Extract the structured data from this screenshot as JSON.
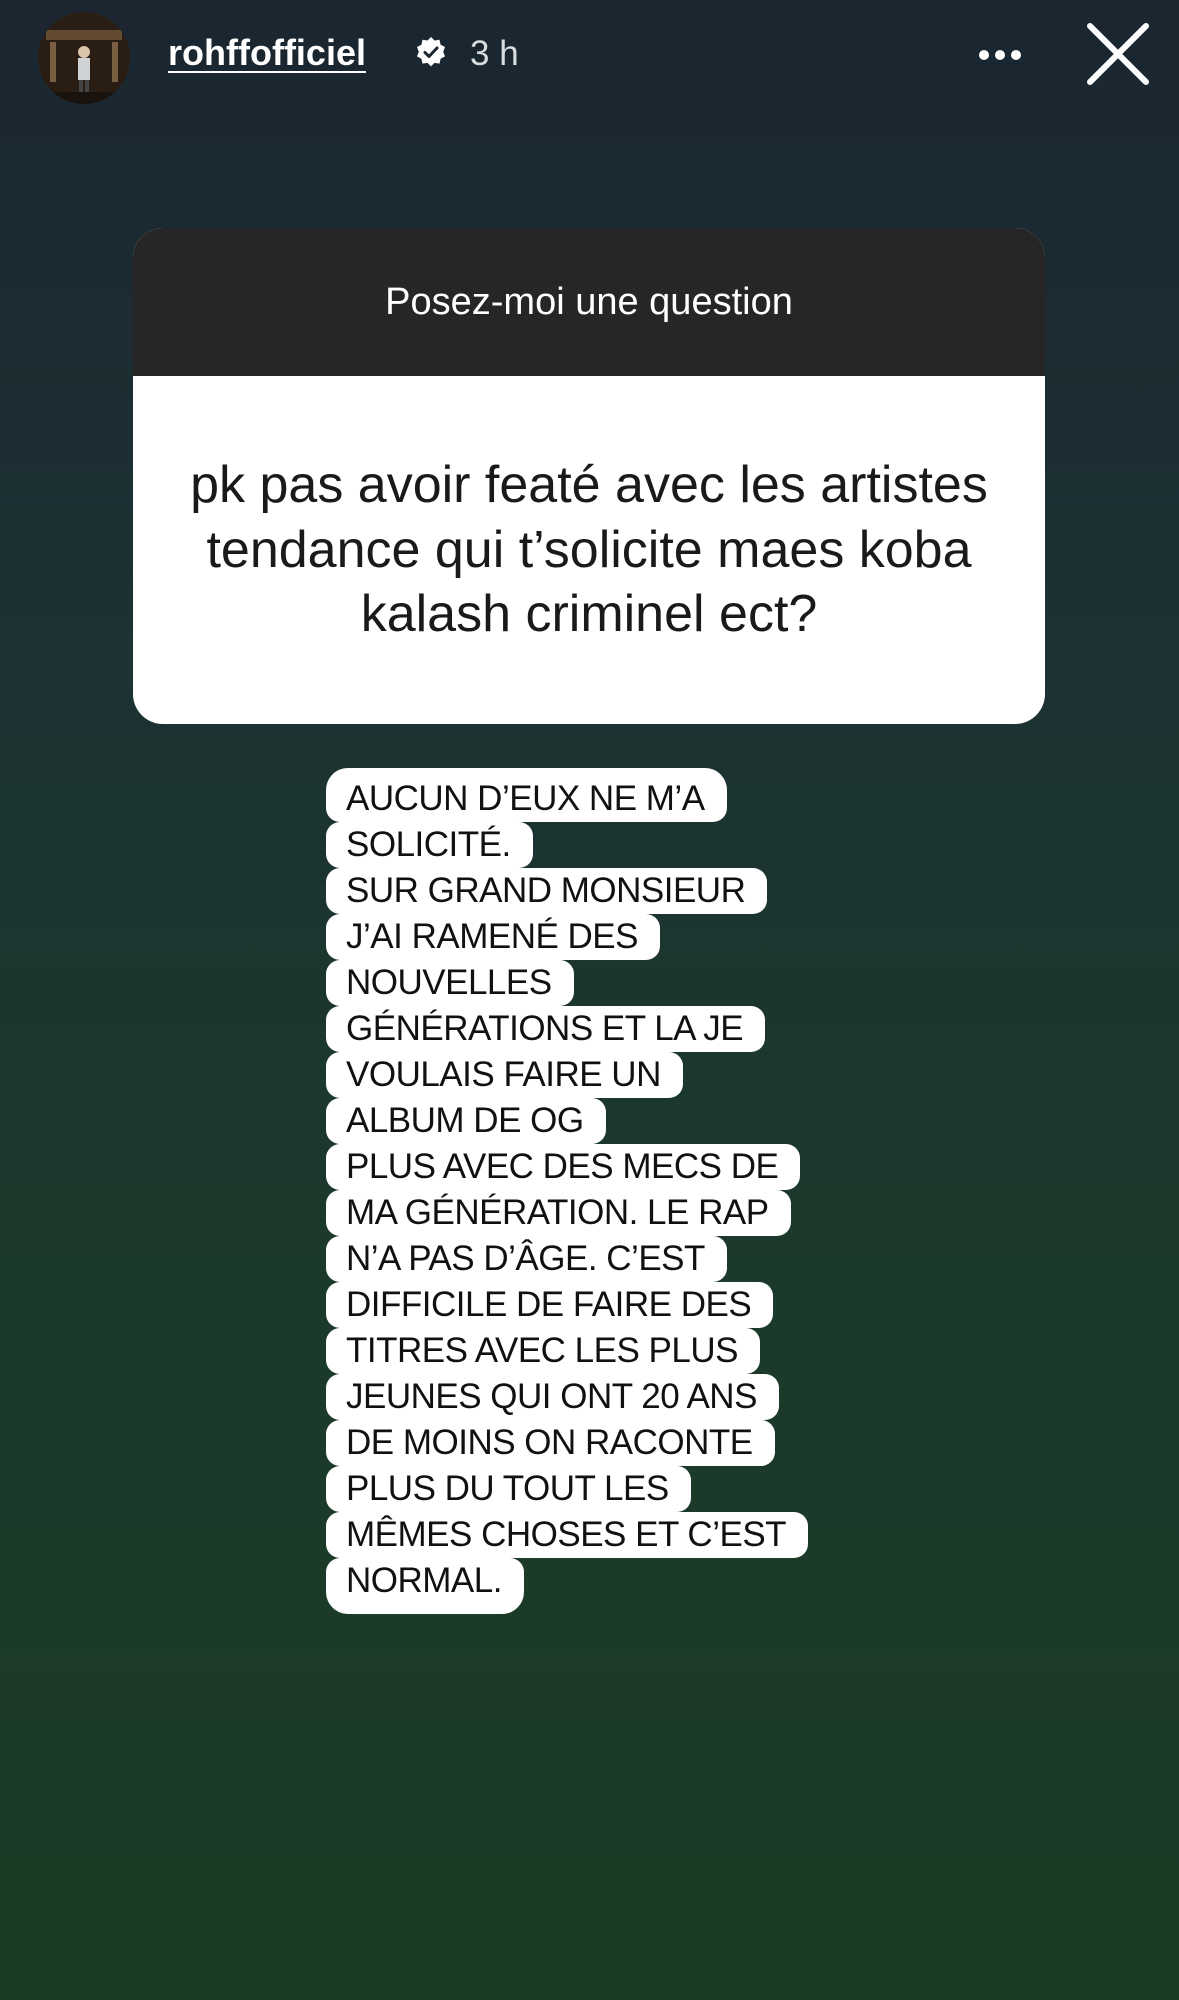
{
  "header": {
    "username": "rohffofficiel",
    "time": "3 h",
    "verified_icon": "verified-badge-icon",
    "more_icon": "more-horizontal-icon",
    "close_icon": "close-icon"
  },
  "question_card": {
    "header_text": "Posez-moi une question",
    "question_text": "pk pas avoir featé avec les artistes tendance qui t’solicite maes koba kalash criminel ect?"
  },
  "answer": {
    "lines": [
      "AUCUN D’EUX NE M’A",
      "SOLICITÉ.",
      "SUR GRAND MONSIEUR",
      "J’AI RAMENÉ DES",
      "NOUVELLES",
      "GÉNÉRATIONS ET LA JE",
      "VOULAIS FAIRE UN",
      "ALBUM DE OG",
      "PLUS AVEC DES MECS DE",
      "MA GÉNÉRATION. LE RAP",
      "N’A PAS D’ÂGE. C’EST",
      "DIFFICILE DE FAIRE DES",
      "TITRES AVEC LES PLUS",
      "JEUNES QUI ONT 20 ANS",
      "DE MOINS ON RACONTE",
      "PLUS DU TOUT LES",
      "MÊMES CHOSES ET C’EST",
      "NORMAL."
    ]
  },
  "colors": {
    "bg_top": "#1b2630",
    "bg_bottom": "#1b3b24",
    "card_header": "#262626",
    "card_body": "#ffffff"
  }
}
